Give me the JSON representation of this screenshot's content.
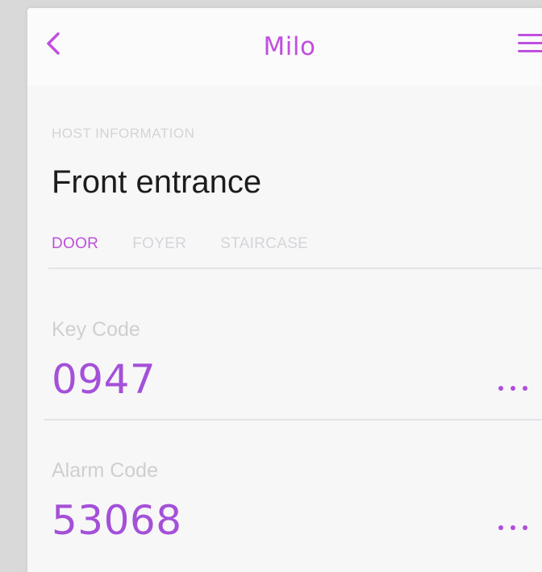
{
  "header": {
    "title": "Milo",
    "back_icon": "chevron-left-icon",
    "menu_icon": "hamburger-menu-icon"
  },
  "section": {
    "label": "HOST INFORMATION",
    "heading": "Front entrance"
  },
  "tabs": [
    {
      "label": "DOOR",
      "active": true
    },
    {
      "label": "FOYER",
      "active": false
    },
    {
      "label": "STAIRCASE",
      "active": false
    }
  ],
  "fields": [
    {
      "label": "Key Code",
      "value": "0947"
    },
    {
      "label": "Alarm Code",
      "value": "53068"
    }
  ],
  "colors": {
    "accent": "#c04fe0",
    "value": "#a450d8",
    "label": "#cfcfd1"
  }
}
